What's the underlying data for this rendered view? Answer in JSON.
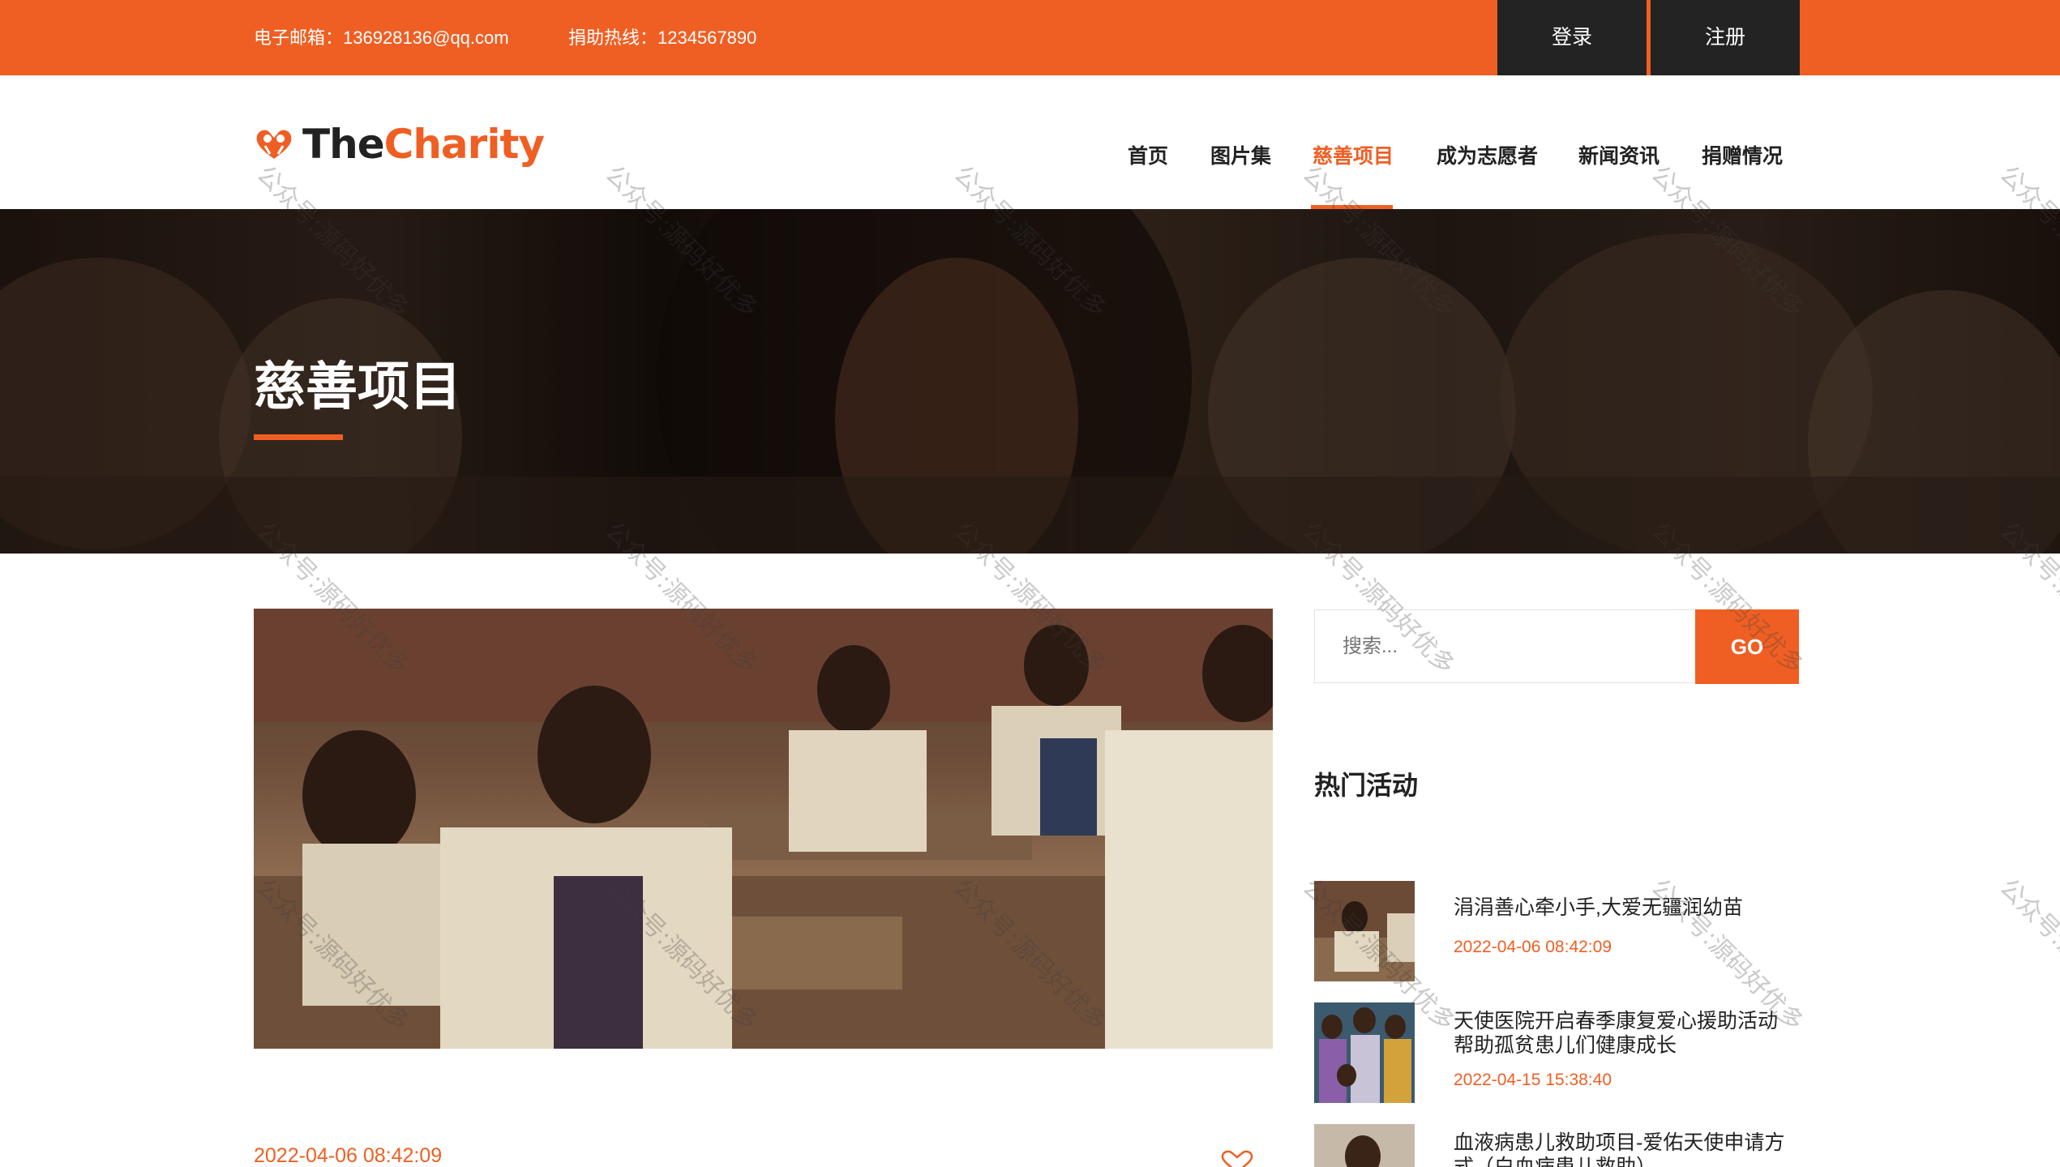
{
  "topbar": {
    "email": "电子邮箱：136928136@qq.com",
    "hotline": "捐助热线：1234567890",
    "login": "登录",
    "register": "注册"
  },
  "logo": {
    "part1": "The",
    "part2": "Charity"
  },
  "nav": [
    {
      "label": "首页",
      "active": false
    },
    {
      "label": "图片集",
      "active": false
    },
    {
      "label": "慈善项目",
      "active": true
    },
    {
      "label": "成为志愿者",
      "active": false
    },
    {
      "label": "新闻资讯",
      "active": false
    },
    {
      "label": "捐赠情况",
      "active": false
    }
  ],
  "hero": {
    "title": "慈善项目"
  },
  "post": {
    "date": "2022-04-06 08:42:09"
  },
  "sidebar": {
    "search_placeholder": "搜索...",
    "search_button": "GO",
    "hot_title": "热门活动",
    "activities": [
      {
        "title": "涓涓善心牵小手,大爱无疆润幼苗",
        "date": "2022-04-06 08:42:09"
      },
      {
        "title": "天使医院开启春季康复爱心援助活动 帮助孤贫患儿们健康成长",
        "date": "2022-04-15 15:38:40"
      },
      {
        "title": "血液病患儿救助项目-爱佑天使申请方式（白血病患儿救助）",
        "date": ""
      }
    ]
  },
  "watermark": "公众号:源码好优多",
  "colors": {
    "accent": "#ef5f23",
    "dark": "#232323"
  }
}
